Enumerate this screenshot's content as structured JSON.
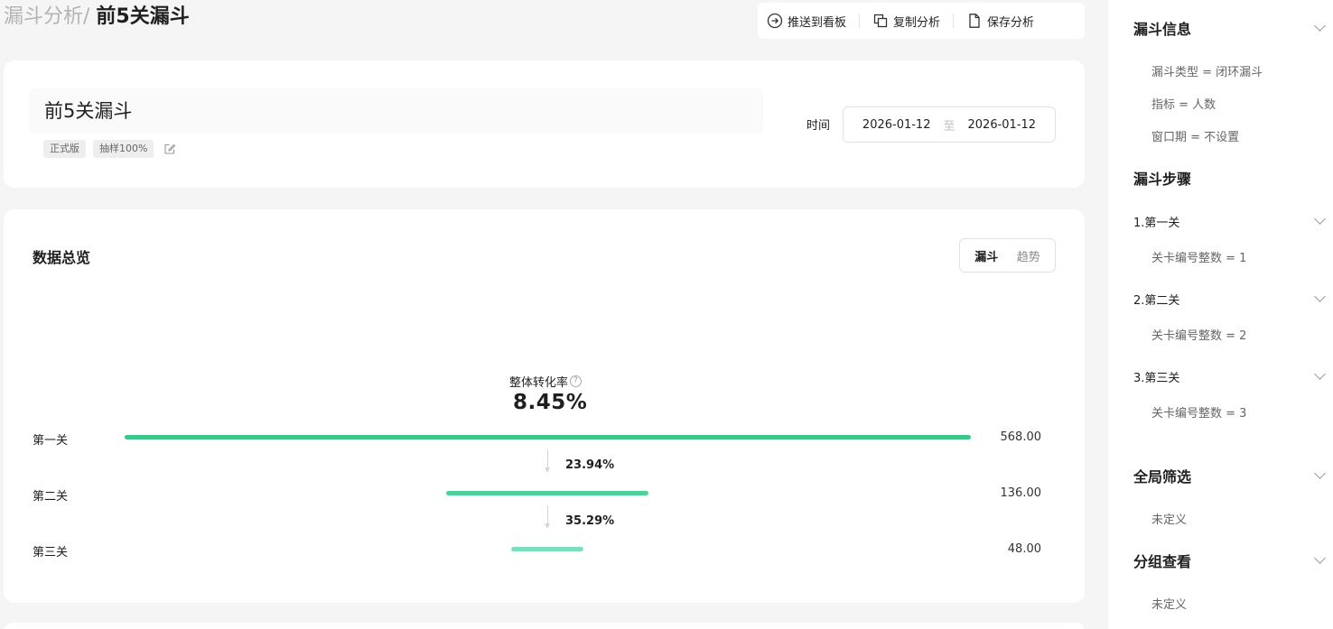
{
  "breadcrumb": {
    "parent": "漏斗分析/",
    "current": "前5关漏斗"
  },
  "toolbar": {
    "push": "推送到看板",
    "copy": "复制分析",
    "save": "保存分析"
  },
  "header": {
    "title": "前5关漏斗",
    "tags": [
      "正式版",
      "抽样100%"
    ],
    "time_label": "时间",
    "date_start": "2026-01-12",
    "date_sep": "至",
    "date_end": "2026-01-12"
  },
  "overview": {
    "title": "数据总览",
    "tabs": [
      "漏斗",
      "趋势"
    ],
    "active_tab": "漏斗",
    "overall_label": "整体转化率",
    "overall_value": "8.45%"
  },
  "chart_data": {
    "type": "bar",
    "categories": [
      "第一关",
      "第二关",
      "第三关"
    ],
    "values": [
      568.0,
      136.0,
      48.0
    ],
    "value_labels": [
      "568.00",
      "136.00",
      "48.00"
    ],
    "conversion_rates": [
      "23.94%",
      "35.29%"
    ],
    "colors": [
      "#3cc68a",
      "#4dd19a",
      "#7bdfbb"
    ]
  },
  "sidepanel": {
    "funnel_info": {
      "title": "漏斗信息",
      "items": [
        "漏斗类型 = 闭环漏斗",
        "指标 = 人数",
        "窗口期 = 不设置"
      ]
    },
    "steps": {
      "title": "漏斗步骤",
      "items": [
        {
          "label": "1.第一关",
          "condition": "关卡编号整数 = 1"
        },
        {
          "label": "2.第二关",
          "condition": "关卡编号整数 = 2"
        },
        {
          "label": "3.第三关",
          "condition": "关卡编号整数 = 3"
        }
      ]
    },
    "global_filter": {
      "title": "全局筛选",
      "value": "未定义"
    },
    "group_by": {
      "title": "分组查看",
      "value": "未定义"
    }
  }
}
